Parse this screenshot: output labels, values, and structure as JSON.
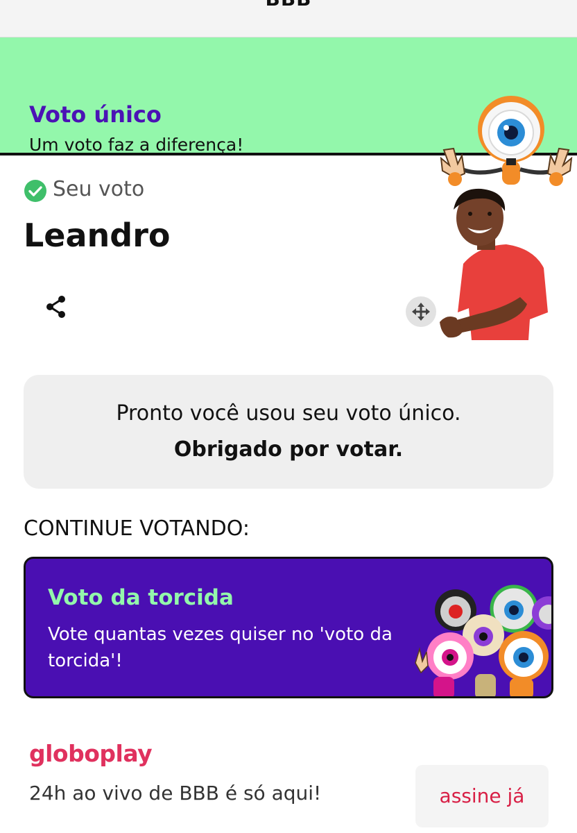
{
  "header": {
    "title": "BBB"
  },
  "banner": {
    "title": "Voto único",
    "subtitle": "Um voto faz a diferença!",
    "bg_color": "#93f7ab",
    "title_color": "#4b12b5",
    "mascot_icon": "big-brother-eye-mascot"
  },
  "vote": {
    "label": "Seu voto",
    "status_icon": "check-circle-icon",
    "candidate": "Leandro",
    "share_icon": "share-icon",
    "move_icon": "move-arrows-icon"
  },
  "info": {
    "line1": "Pronto você usou seu voto único.",
    "line2": "Obrigado por votar."
  },
  "continue_label": "CONTINUE VOTANDO:",
  "torcida": {
    "title": "Voto da torcida",
    "description": "Vote quantas vezes quiser no 'voto da torcida'!",
    "bg_color": "#4a0fb2",
    "title_color": "#93f7ab"
  },
  "globoplay": {
    "logo": "globoplay",
    "text": "24h ao vivo de BBB é só aqui!",
    "button": "assine já",
    "brand_color": "#e0315e"
  }
}
